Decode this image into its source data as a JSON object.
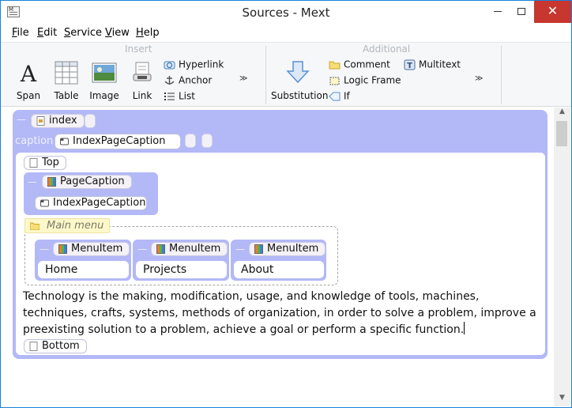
{
  "window": {
    "title": "Sources - Mext"
  },
  "menu": [
    "File",
    "Edit",
    "Service",
    "View",
    "Help"
  ],
  "ribbon": {
    "insert_label": "Insert",
    "additional_label": "Additional",
    "insert": {
      "span": "Span",
      "table": "Table",
      "image": "Image",
      "link": "Link",
      "hyperlink": "Hyperlink",
      "anchor": "Anchor",
      "list": "List"
    },
    "additional": {
      "substitution": "Substitution",
      "comment": "Comment",
      "logic_frame": "Logic Frame",
      "if": "If",
      "multitext": "Multitext"
    },
    "more_glyph": "≫"
  },
  "document": {
    "root_tag": "index",
    "caption_label": "caption",
    "caption_value": "IndexPageCaption",
    "top_tag": "Top",
    "page_caption_tag": "PageCaption",
    "page_caption_value": "IndexPageCaption",
    "main_menu_label": "Main menu",
    "menu_items": [
      {
        "tag": "MenuItem",
        "value": "Home"
      },
      {
        "tag": "MenuItem",
        "value": "Projects"
      },
      {
        "tag": "MenuItem",
        "value": "About"
      }
    ],
    "paragraph": "Technology is the making, modification, usage, and knowledge of tools, machines, techniques, crafts, systems, methods of organization, in order to solve a problem, improve a preexisting solution to a problem, achieve a goal or perform a specific function.",
    "bottom_tag": "Bottom",
    "collapse_glyph": "—"
  },
  "colors": {
    "accent": "#b3b8f7",
    "close": "#c7372f",
    "note": "#fdf8c9"
  }
}
